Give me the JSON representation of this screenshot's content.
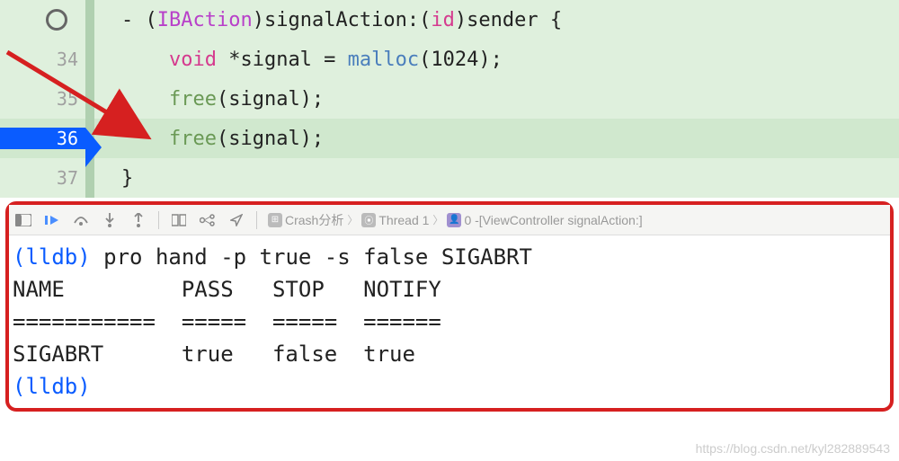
{
  "editor": {
    "lines": [
      {
        "num": "",
        "hasCircle": true
      },
      {
        "num": "34"
      },
      {
        "num": "35"
      },
      {
        "num": "36",
        "current": true
      },
      {
        "num": "37"
      }
    ],
    "code": {
      "line1_prefix": "- (",
      "line1_action": "IBAction",
      "line1_mid": ")signalAction:(",
      "line1_id": "id",
      "line1_end": ")sender {",
      "line2_void": "void",
      "line2_mid": " *signal = ",
      "line2_malloc": "malloc",
      "line2_end": "(1024);",
      "line3_free": "free",
      "line3_end": "(signal);",
      "line4_free": "free",
      "line4_end": "(signal);",
      "line5": "}"
    }
  },
  "breadcrumb": {
    "item1": "Crash分析",
    "item2": "Thread 1",
    "item3": "0 -[ViewController signalAction:]"
  },
  "console": {
    "prompt": "(lldb)",
    "cmd": " pro hand -p true -s false SIGABRT",
    "headers": "NAME         PASS   STOP   NOTIFY",
    "divider": "===========  =====  =====  ======",
    "row": "SIGABRT      true   false  true  "
  },
  "watermark": "https://blog.csdn.net/kyl282889543"
}
